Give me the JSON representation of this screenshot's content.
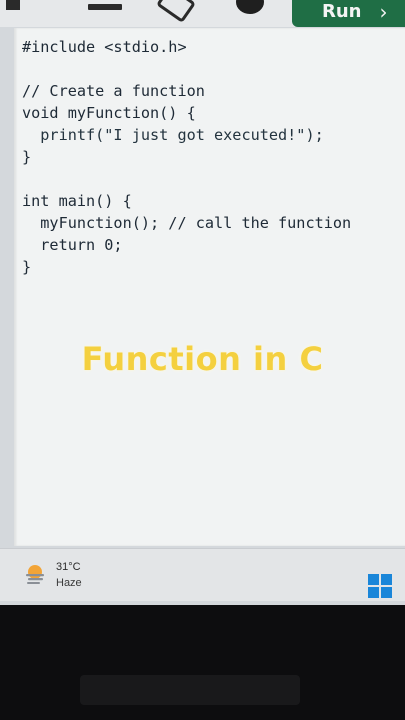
{
  "toolbar": {
    "run_label": "Run",
    "run_chevron": "›",
    "icons": [
      "home-icon",
      "minus-icon",
      "tag-icon",
      "theme-circle-icon"
    ]
  },
  "editor": {
    "lines": [
      "#include <stdio.h>",
      "",
      "// Create a function",
      "void myFunction() {",
      "  printf(\"I just got executed!\");",
      "}",
      "",
      "int main() {",
      "  myFunction(); // call the function",
      "  return 0;",
      "}"
    ]
  },
  "overlay": {
    "title": "Function in C",
    "color": "#f4d03f"
  },
  "taskbar": {
    "weather_temp": "31°C",
    "weather_condition": "Haze",
    "weather_icon": "haze-sun-icon",
    "start_icon": "windows-start-icon"
  },
  "colors": {
    "run_button": "#1f6e45",
    "editor_bg": "#f1f3f3",
    "windows_blue": "#1a86d9"
  }
}
